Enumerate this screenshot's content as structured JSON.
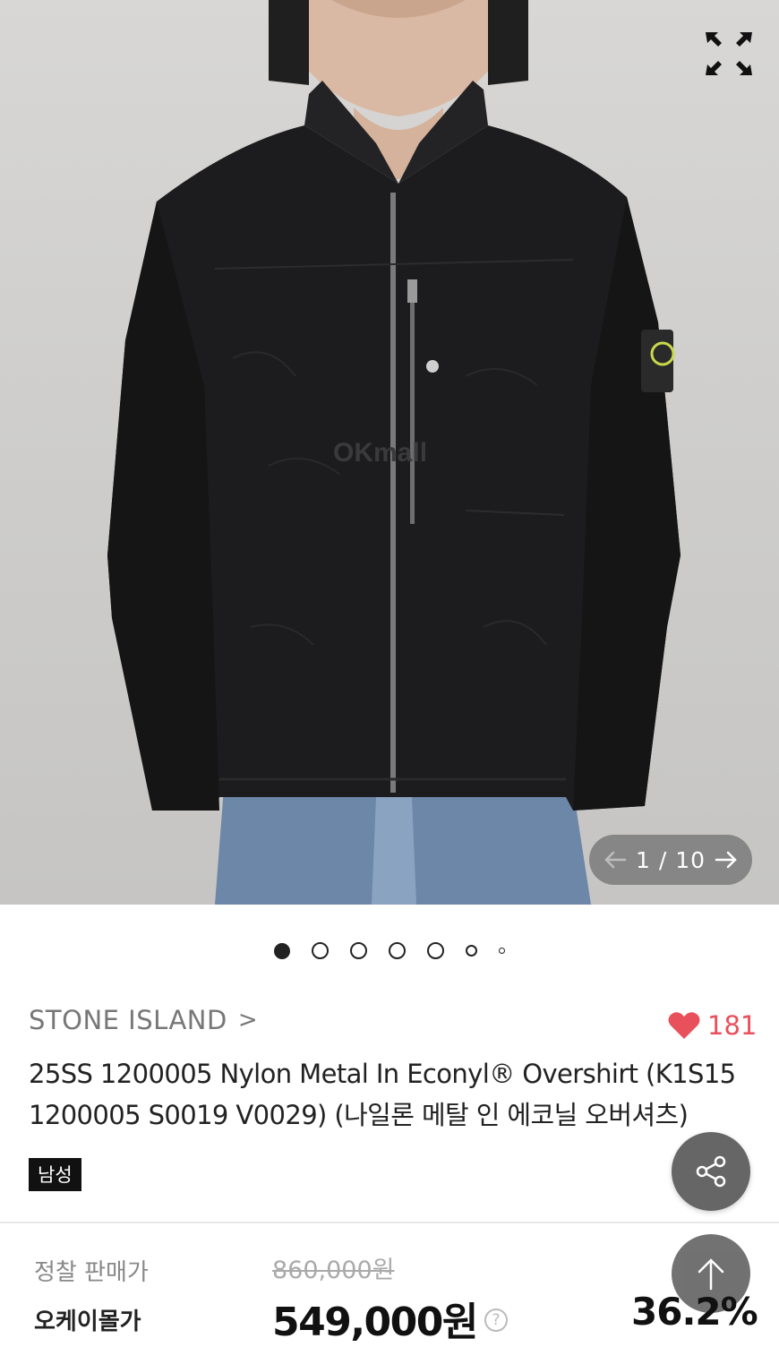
{
  "gallery": {
    "current": "1",
    "separator": "/",
    "total": "10",
    "count_text": "1 / 10",
    "watermark": "OKmall",
    "dots_count": 7,
    "active_dot": 0
  },
  "product": {
    "brand": "STONE ISLAND",
    "brand_chevron": ">",
    "likes": "181",
    "title": "25SS  1200005 Nylon Metal In Econyl® Overshirt (K1S15 1200005 S0019 V0029) (나일론 메탈 인 에코닐 오버셔츠)",
    "gender_badge": "남성"
  },
  "pricing": {
    "list_price_label": "정찰 판매가",
    "list_price": "860,000원",
    "sale_label": "오케이몰가",
    "sale_price": "549,000원",
    "help_glyph": "?",
    "discount": "36.2%"
  },
  "icons": {
    "expand": "expand-icon",
    "prev": "arrow-left-icon",
    "next": "arrow-right-icon",
    "like": "heart-icon",
    "share": "share-icon",
    "top": "arrow-up-icon"
  },
  "colors": {
    "heart": "#e8505b",
    "badge_bg": "#111111",
    "floating_button": "#666666"
  }
}
